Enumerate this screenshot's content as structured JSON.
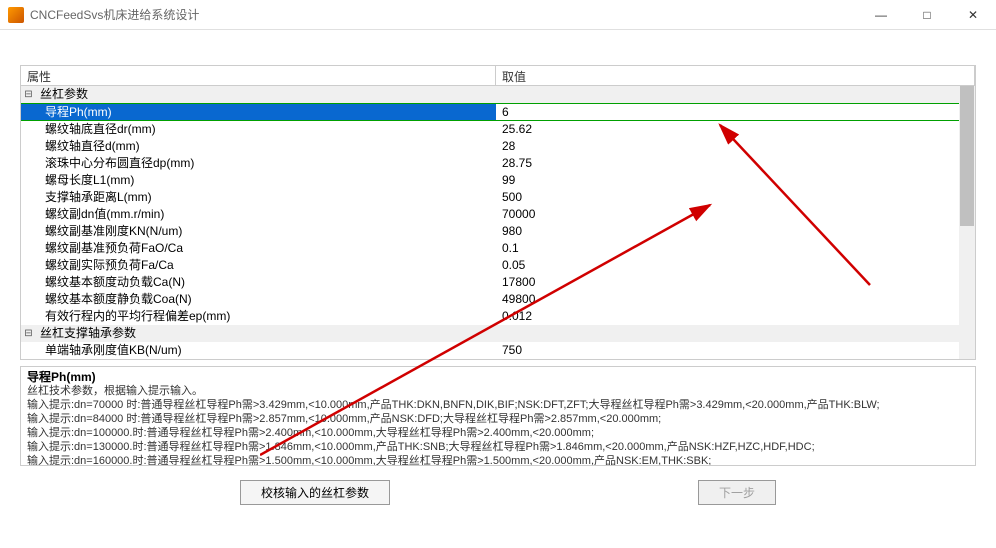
{
  "window": {
    "title": "CNCFeedSvs机床进给系统设计"
  },
  "grid": {
    "headers": {
      "name": "属性",
      "value": "取值"
    },
    "categories": [
      {
        "label": "丝杠参数",
        "props": [
          {
            "name": "导程Ph(mm)",
            "value": "6",
            "selected": true
          },
          {
            "name": "螺纹轴底直径dr(mm)",
            "value": "25.62"
          },
          {
            "name": "螺纹轴直径d(mm)",
            "value": "28"
          },
          {
            "name": "滚珠中心分布圆直径dp(mm)",
            "value": "28.75"
          },
          {
            "name": "螺母长度L1(mm)",
            "value": "99"
          },
          {
            "name": "支撑轴承距离L(mm)",
            "value": "500"
          },
          {
            "name": "螺纹副dn值(mm.r/min)",
            "value": "70000"
          },
          {
            "name": "螺纹副基准刚度KN(N/um)",
            "value": "980"
          },
          {
            "name": "螺纹副基准预负荷FaO/Ca",
            "value": "0.1"
          },
          {
            "name": "螺纹副实际预负荷Fa/Ca",
            "value": "0.05"
          },
          {
            "name": "螺纹基本额度动负载Ca(N)",
            "value": "17800"
          },
          {
            "name": "螺纹基本额度静负载Coa(N)",
            "value": "49800"
          },
          {
            "name": "有效行程内的平均行程偏差ep(mm)",
            "value": "0.012"
          }
        ]
      },
      {
        "label": "丝杠支撑轴承参数",
        "props": [
          {
            "name": "单端轴承刚度值KB(N/um)",
            "value": "750"
          }
        ]
      }
    ]
  },
  "help": {
    "title": "导程Ph(mm)",
    "lines": [
      "丝杠技术参数，根据输入提示输入。",
      "输入提示:dn=70000 时:普通导程丝杠导程Ph需>3.429mm,<10.000mm,产品THK:DKN,BNFN,DIK,BIF;NSK:DFT,ZFT;大导程丝杠导程Ph需>3.429mm,<20.000mm,产品THK:BLW;",
      "输入提示:dn=84000 时:普通导程丝杠导程Ph需>2.857mm,<10.000mm,产品NSK:DFD;大导程丝杠导程Ph需>2.857mm,<20.000mm;",
      "输入提示:dn=100000.时:普通导程丝杠导程Ph需>2.400mm,<10.000mm,大导程丝杠导程Ph需>2.400mm,<20.000mm;",
      "输入提示:dn=130000.时:普通导程丝杠导程Ph需>1.846mm,<10.000mm,产品THK:SNB;大导程丝杠导程Ph需>1.846mm,<20.000mm,产品NSK:HZF,HZC,HDF,HDC;",
      "输入提示:dn=160000.时:普通导程丝杠导程Ph需>1.500mm,<10.000mm,大导程丝杠导程Ph需>1.500mm,<20.000mm,产品NSK:EM,THK:SBK;"
    ]
  },
  "buttons": {
    "verify": "校核输入的丝杠参数",
    "next": "下一步"
  }
}
